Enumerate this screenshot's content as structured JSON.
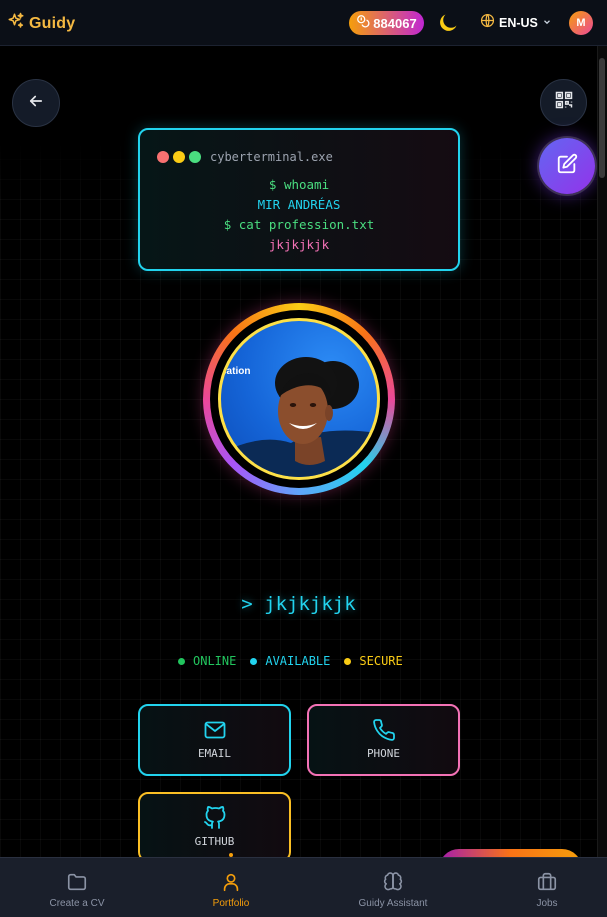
{
  "header": {
    "brand_name": "Guidy",
    "brand_icon": "sparkles-icon",
    "points": "884067",
    "points_icon": "coins-icon",
    "theme_icon": "moon-icon",
    "language": "EN-US",
    "user_initial": "M"
  },
  "actions": {
    "back_icon": "arrow-left-icon",
    "qr_icon": "qr-code-icon",
    "edit_icon": "edit-icon"
  },
  "terminal": {
    "title": "cyberterminal.exe",
    "lines": [
      "$ whoami",
      "MIR ANDRÉAS",
      "$ cat profession.txt",
      "jkjkjkjk"
    ]
  },
  "profile": {
    "photo_tag": "cation",
    "display_name": "> jkjkjkjk"
  },
  "status": [
    {
      "label": "ONLINE",
      "color": "#22c55e"
    },
    {
      "label": "AVAILABLE",
      "color": "#22d3ee"
    },
    {
      "label": "SECURE",
      "color": "#facc15"
    }
  ],
  "contacts": {
    "email": "EMAIL",
    "phone": "PHONE",
    "github": "GITHUB"
  },
  "nav": [
    {
      "label": "Create a CV",
      "icon": "folder-icon"
    },
    {
      "label": "Portfolio",
      "icon": "user-icon",
      "active": true
    },
    {
      "label": "Guidy Assistant",
      "icon": "brain-icon"
    },
    {
      "label": "Jobs",
      "icon": "briefcase-icon"
    }
  ],
  "colors": {
    "accent": "#f59e0b",
    "cyan": "#22d3ee",
    "pink": "#f472b6",
    "yellow": "#fbbf24",
    "background": "#000000"
  }
}
